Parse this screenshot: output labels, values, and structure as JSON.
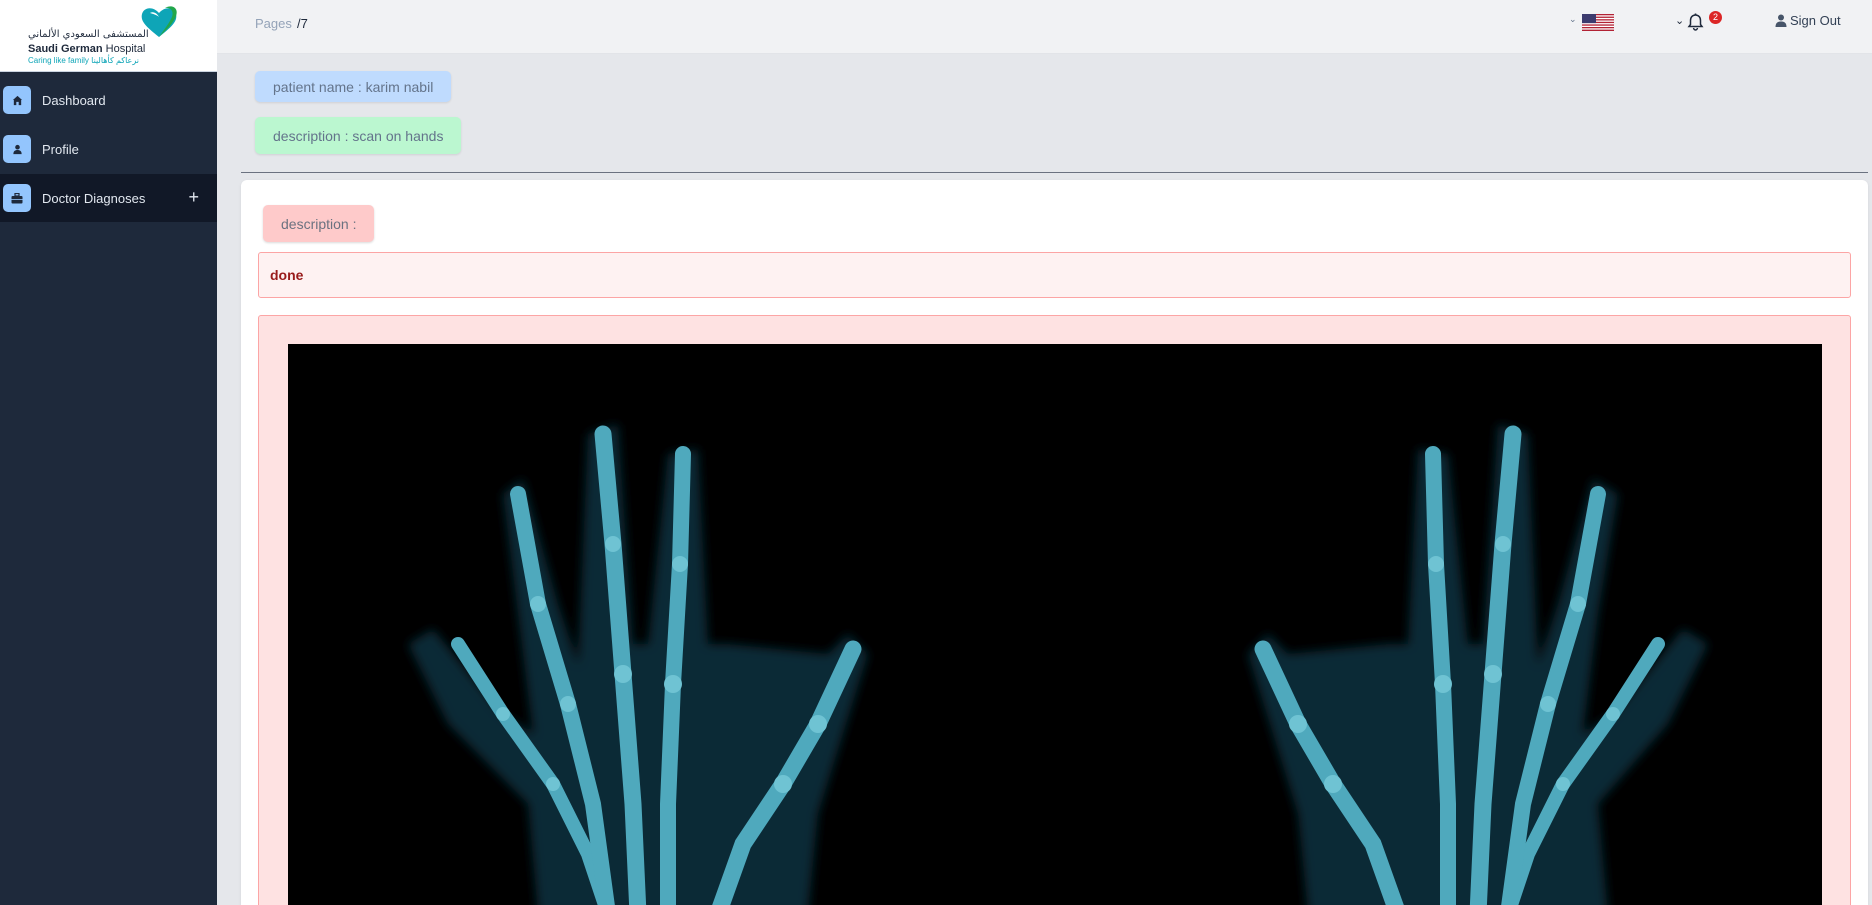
{
  "logo": {
    "arabic": "المستشفى السعودي الألماني",
    "name_bold": "Saudi German",
    "name_rest": " Hospital",
    "tagline": "Caring like family  نرعاكم كأهالينا"
  },
  "sidebar": {
    "items": [
      {
        "label": "Dashboard",
        "icon": "home-icon"
      },
      {
        "label": "Profile",
        "icon": "user-icon"
      },
      {
        "label": "Doctor Diagnoses",
        "icon": "briefcase-icon",
        "expand": "+"
      }
    ]
  },
  "topbar": {
    "breadcrumb_root": "Pages",
    "breadcrumb_current": "/7",
    "notification_count": "2",
    "signout_label": "Sign Out"
  },
  "record": {
    "patient_label": "patient name : karim nabil",
    "description_label": "description : scan on hands"
  },
  "diagnosis": {
    "description_heading": "description :",
    "status_text": "done"
  },
  "colors": {
    "sidebar_bg": "#1e293b",
    "patient_pill": "#bfdbfe",
    "description_pill": "#bbf7d0",
    "diagnosis_pill": "#fecaca",
    "done_text": "#991b1b"
  }
}
